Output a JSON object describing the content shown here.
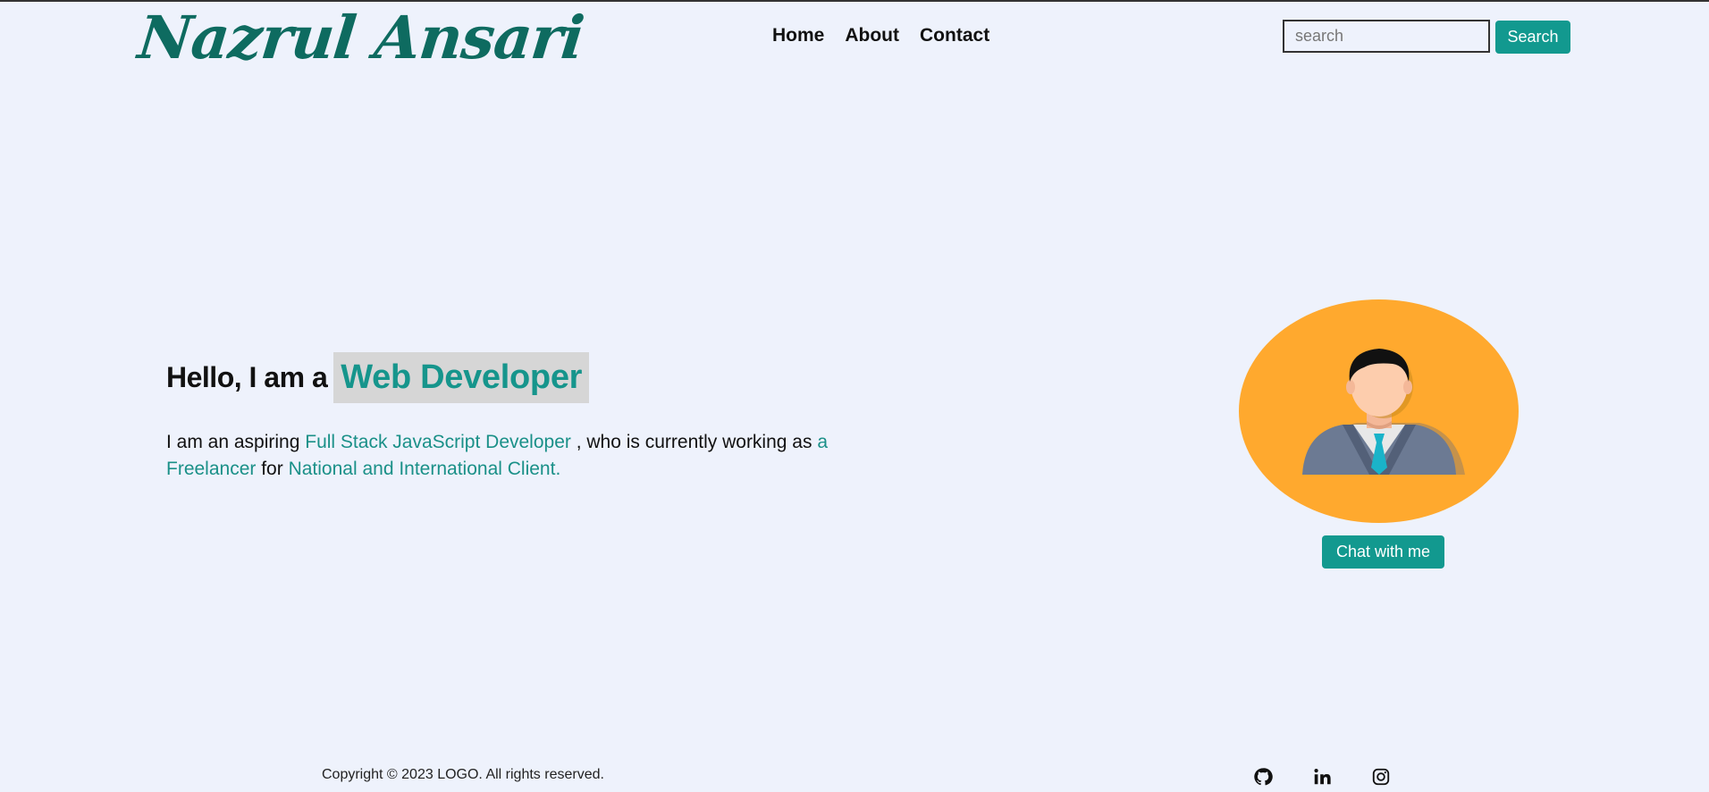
{
  "header": {
    "logo_text": "Nazrul Ansari",
    "nav": [
      {
        "label": "Home"
      },
      {
        "label": "About"
      },
      {
        "label": "Contact"
      }
    ],
    "search": {
      "placeholder": "search",
      "value": "",
      "button_label": "Search"
    }
  },
  "hero": {
    "title_lead": "Hello, I am a",
    "title_highlight": "Web Developer",
    "desc": {
      "p1": "I am an aspiring ",
      "h1": "Full Stack JavaScript Developer",
      "p2": " , who is currently working as ",
      "h2": "a Freelancer",
      "p3": " for ",
      "h3": "National and International Client."
    },
    "avatar_icon": "person-avatar-icon",
    "chat_button": "Chat with me"
  },
  "footer": {
    "copyright": "Copyright © 2023 LOGO. All rights reserved.",
    "social_icons": [
      "github-icon",
      "linkedin-icon",
      "instagram-icon"
    ]
  },
  "colors": {
    "accent": "#12998f",
    "logo": "#0e6b60",
    "background": "#eef2fc",
    "avatar_bg": "#ffa92e"
  }
}
